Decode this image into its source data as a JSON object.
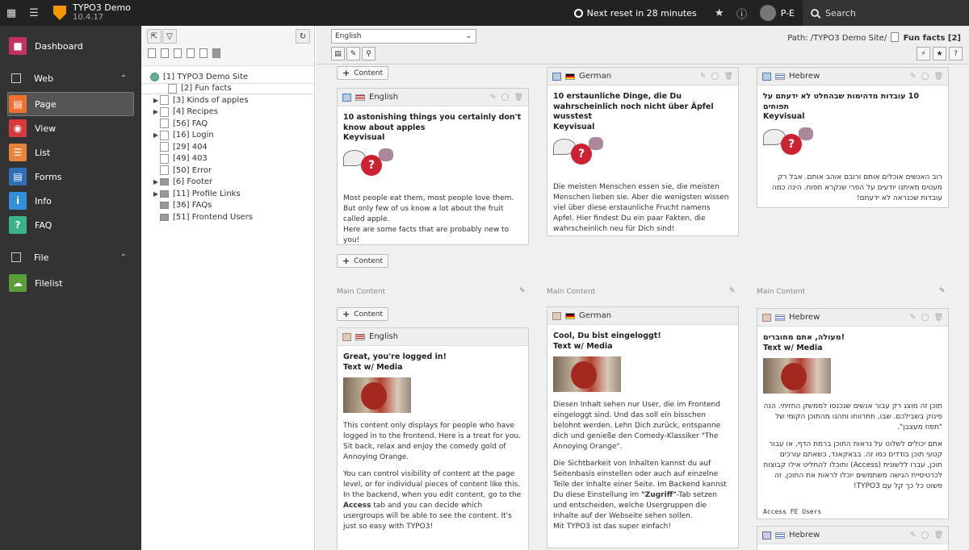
{
  "topbar": {
    "app_title": "TYPO3 Demo",
    "version": "10.4.17",
    "reset_text": "Next reset in 28 minutes",
    "user": "P-E",
    "search_label": "Search"
  },
  "modmenu": {
    "dashboard": "Dashboard",
    "web": "Web",
    "page": "Page",
    "view": "View",
    "list": "List",
    "forms": "Forms",
    "info": "Info",
    "faq": "FAQ",
    "file": "File",
    "filelist": "Filelist",
    "colors": {
      "dashboard": "#c5315e",
      "page": "#f07030",
      "view": "#d63a3a",
      "list": "#e8833a",
      "forms": "#2f6fb5",
      "info": "#3390d8",
      "faq": "#3ab28a",
      "filelist": "#5a9e3a"
    }
  },
  "tree": {
    "root": "[1] TYPO3 Demo Site",
    "nodes": [
      {
        "label": "[2] Fun facts"
      },
      {
        "label": "[3] Kinds of apples"
      },
      {
        "label": "[4] Recipes"
      },
      {
        "label": "[56] FAQ"
      },
      {
        "label": "[16] Login"
      },
      {
        "label": "[29] 404"
      },
      {
        "label": "[49] 403"
      },
      {
        "label": "[50] Error"
      },
      {
        "label": "[6] Footer"
      },
      {
        "label": "[11] Profile Links"
      },
      {
        "label": "[36] FAQs"
      },
      {
        "label": "[51] Frontend Users"
      }
    ]
  },
  "docheader": {
    "language": "English",
    "path_prefix": "Path: /TYPO3 Demo Site/",
    "page_name": "Fun facts [2]"
  },
  "buttons": {
    "content": "Content"
  },
  "main_content_label": "Main Content",
  "cards": {
    "en1": {
      "lang": "English",
      "title": "10 astonishing things you certainly don't know about apples",
      "subtitle": "Keyvisual",
      "body": "Most people eat them, most people love them. But only few of us know a lot about the fruit called apple.",
      "body2": "Here are some facts that are probably new to you!"
    },
    "de1": {
      "lang": "German",
      "title": "10 erstaunliche Dinge, die Du wahrscheinlich noch nicht über Äpfel wusstest",
      "subtitle": "Keyvisual",
      "body": "Die meisten Menschen essen sie, die meisten Menschen lieben sie. Aber die wenigsten wissen viel über diese erstaunliche Frucht namens Apfel. Hier findest Du ein paar Fakten, die wahrscheinlich neu für Dich sind!"
    },
    "he1": {
      "lang": "Hebrew",
      "title": "10 עובדות מדהימות שבהחלט לא ידעתם על תפוחים",
      "subtitle": "Keyvisual",
      "body": "רוב האנשים אוכלים אותם ורובם אוהב אותם. אבל רק מעטים מאיתנו יודעים על הפרי שנקרא תפוח. הינה כמה עובדות שכנראה לא ידעתם!"
    },
    "en2": {
      "lang": "English",
      "title": "Great, you're logged in!",
      "subtitle": "Text w/ Media",
      "body": "This content only displays for people who have logged in to the frontend. Here is a treat for you. Sit back, relax and enjoy the comedy gold of Annoying Orange.",
      "body2": "You can control visibility of content at the page level, or for individual pieces of content like this. In the backend, when you edit content, go to the",
      "access_word": "Access",
      "body3": "tab and you can decide which usergroups will be able to see the content. It's just so easy with TYPO3!"
    },
    "de2": {
      "lang": "German",
      "title": "Cool, Du bist eingeloggt!",
      "subtitle": "Text w/ Media",
      "body": "Diesen Inhalt sehen nur User, die im Frontend eingeloggt sind. Und das soll ein bisschen belohnt werden. Lehn Dich zurück, entspanne dich und genieße den Comedy-Klassiker \"The Annoying Orange\".",
      "body2": "Die Sichtbarkeit von Inhalten kannst du auf Seitenbasis einstellen oder auch auf einzelne Teile der Inhalte einer Seite. Im Backend kannst Du diese Einstellung im",
      "zugriff_word": "\"Zugriff\"",
      "body3": "-Tab setzen und entscheiden, welche Usergruppen die Inhalte auf der Webseite sehen sollen.",
      "body4": "Mit TYPO3 ist das super einfach!"
    },
    "he2": {
      "lang": "Hebrew",
      "title": "!מעולה, אתם מחוברים",
      "subtitle": "Text w/ Media",
      "body": "תוכן זה מוצג רק עבור אנשים שנכנסו לממשק החזיתי. הנה פינוק בשבילכם. שבו, תתרווחו ותהנו מהתוכן הקומי של \"תפוז מעצבן\".",
      "body2": "אתם יכולים לשלוט על נראות התוכן ברמת הדף, או עבור קטעי תוכן בודדים כמו זה. בבאקאנד, כשאתם עורכים תוכן, עברו ללשונית (Access) ותוכלו להחליט אילו קבוצות לכרטיסיית הגישה משתמשים יוכלו לראות את התוכן. זה פשוט כל כך קל עם TYPO3!",
      "access": "Access FE Users"
    },
    "he3": {
      "lang": "Hebrew"
    }
  }
}
